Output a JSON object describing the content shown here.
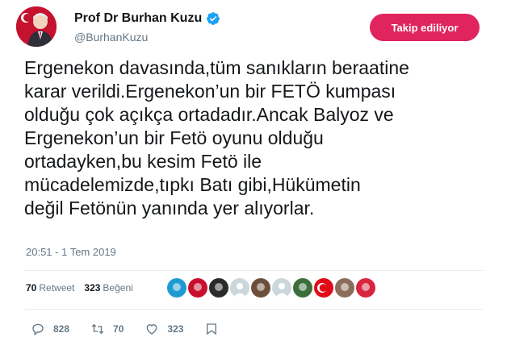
{
  "author": {
    "name": "Prof Dr Burhan Kuzu",
    "handle": "@BurhanKuzu",
    "verified": true
  },
  "follow_button": {
    "label": "Takip ediliyor",
    "color": "#e0245e"
  },
  "tweet": {
    "text": "Ergenekon davasında,tüm sanıkların beraatine\nkarar verildi.Ergenekon’un bir FETÖ kumpası\nolduğu çok açıkça ortadadır.Ancak Balyoz ve\nErgenekon’un bir Fetö oyunu olduğu\nortadayken,bu kesim Fetö ile\nmücadelemizde,tıpkı Batı gibi,Hükümetin\ndeğil Fetönün yanında yer alıyorlar.",
    "timestamp": "20:51 - 1 Tem 2019"
  },
  "stats": {
    "retweets_count": "70",
    "retweets_label": "Retweet",
    "likes_count": "323",
    "likes_label": "Beğeni"
  },
  "likers": [
    {
      "icon": "avatar-blue-emblem",
      "color": "#1d9bd1"
    },
    {
      "icon": "avatar-flag-portrait",
      "color": "#c8102e"
    },
    {
      "icon": "avatar-dark-red",
      "color": "#2b2b2b"
    },
    {
      "icon": "avatar-default",
      "color": "#ccd6dd"
    },
    {
      "icon": "avatar-emblem",
      "color": "#6b4f3a"
    },
    {
      "icon": "avatar-default",
      "color": "#ccd6dd"
    },
    {
      "icon": "avatar-green-emblem",
      "color": "#3c6e3c"
    },
    {
      "icon": "avatar-turkish-flag",
      "color": "#e30a17"
    },
    {
      "icon": "avatar-portrait",
      "color": "#8a6d5a"
    },
    {
      "icon": "avatar-flag-portrait",
      "color": "#d7263d"
    }
  ],
  "actions": {
    "reply_count": "828",
    "retweet_count": "70",
    "like_count": "323"
  }
}
